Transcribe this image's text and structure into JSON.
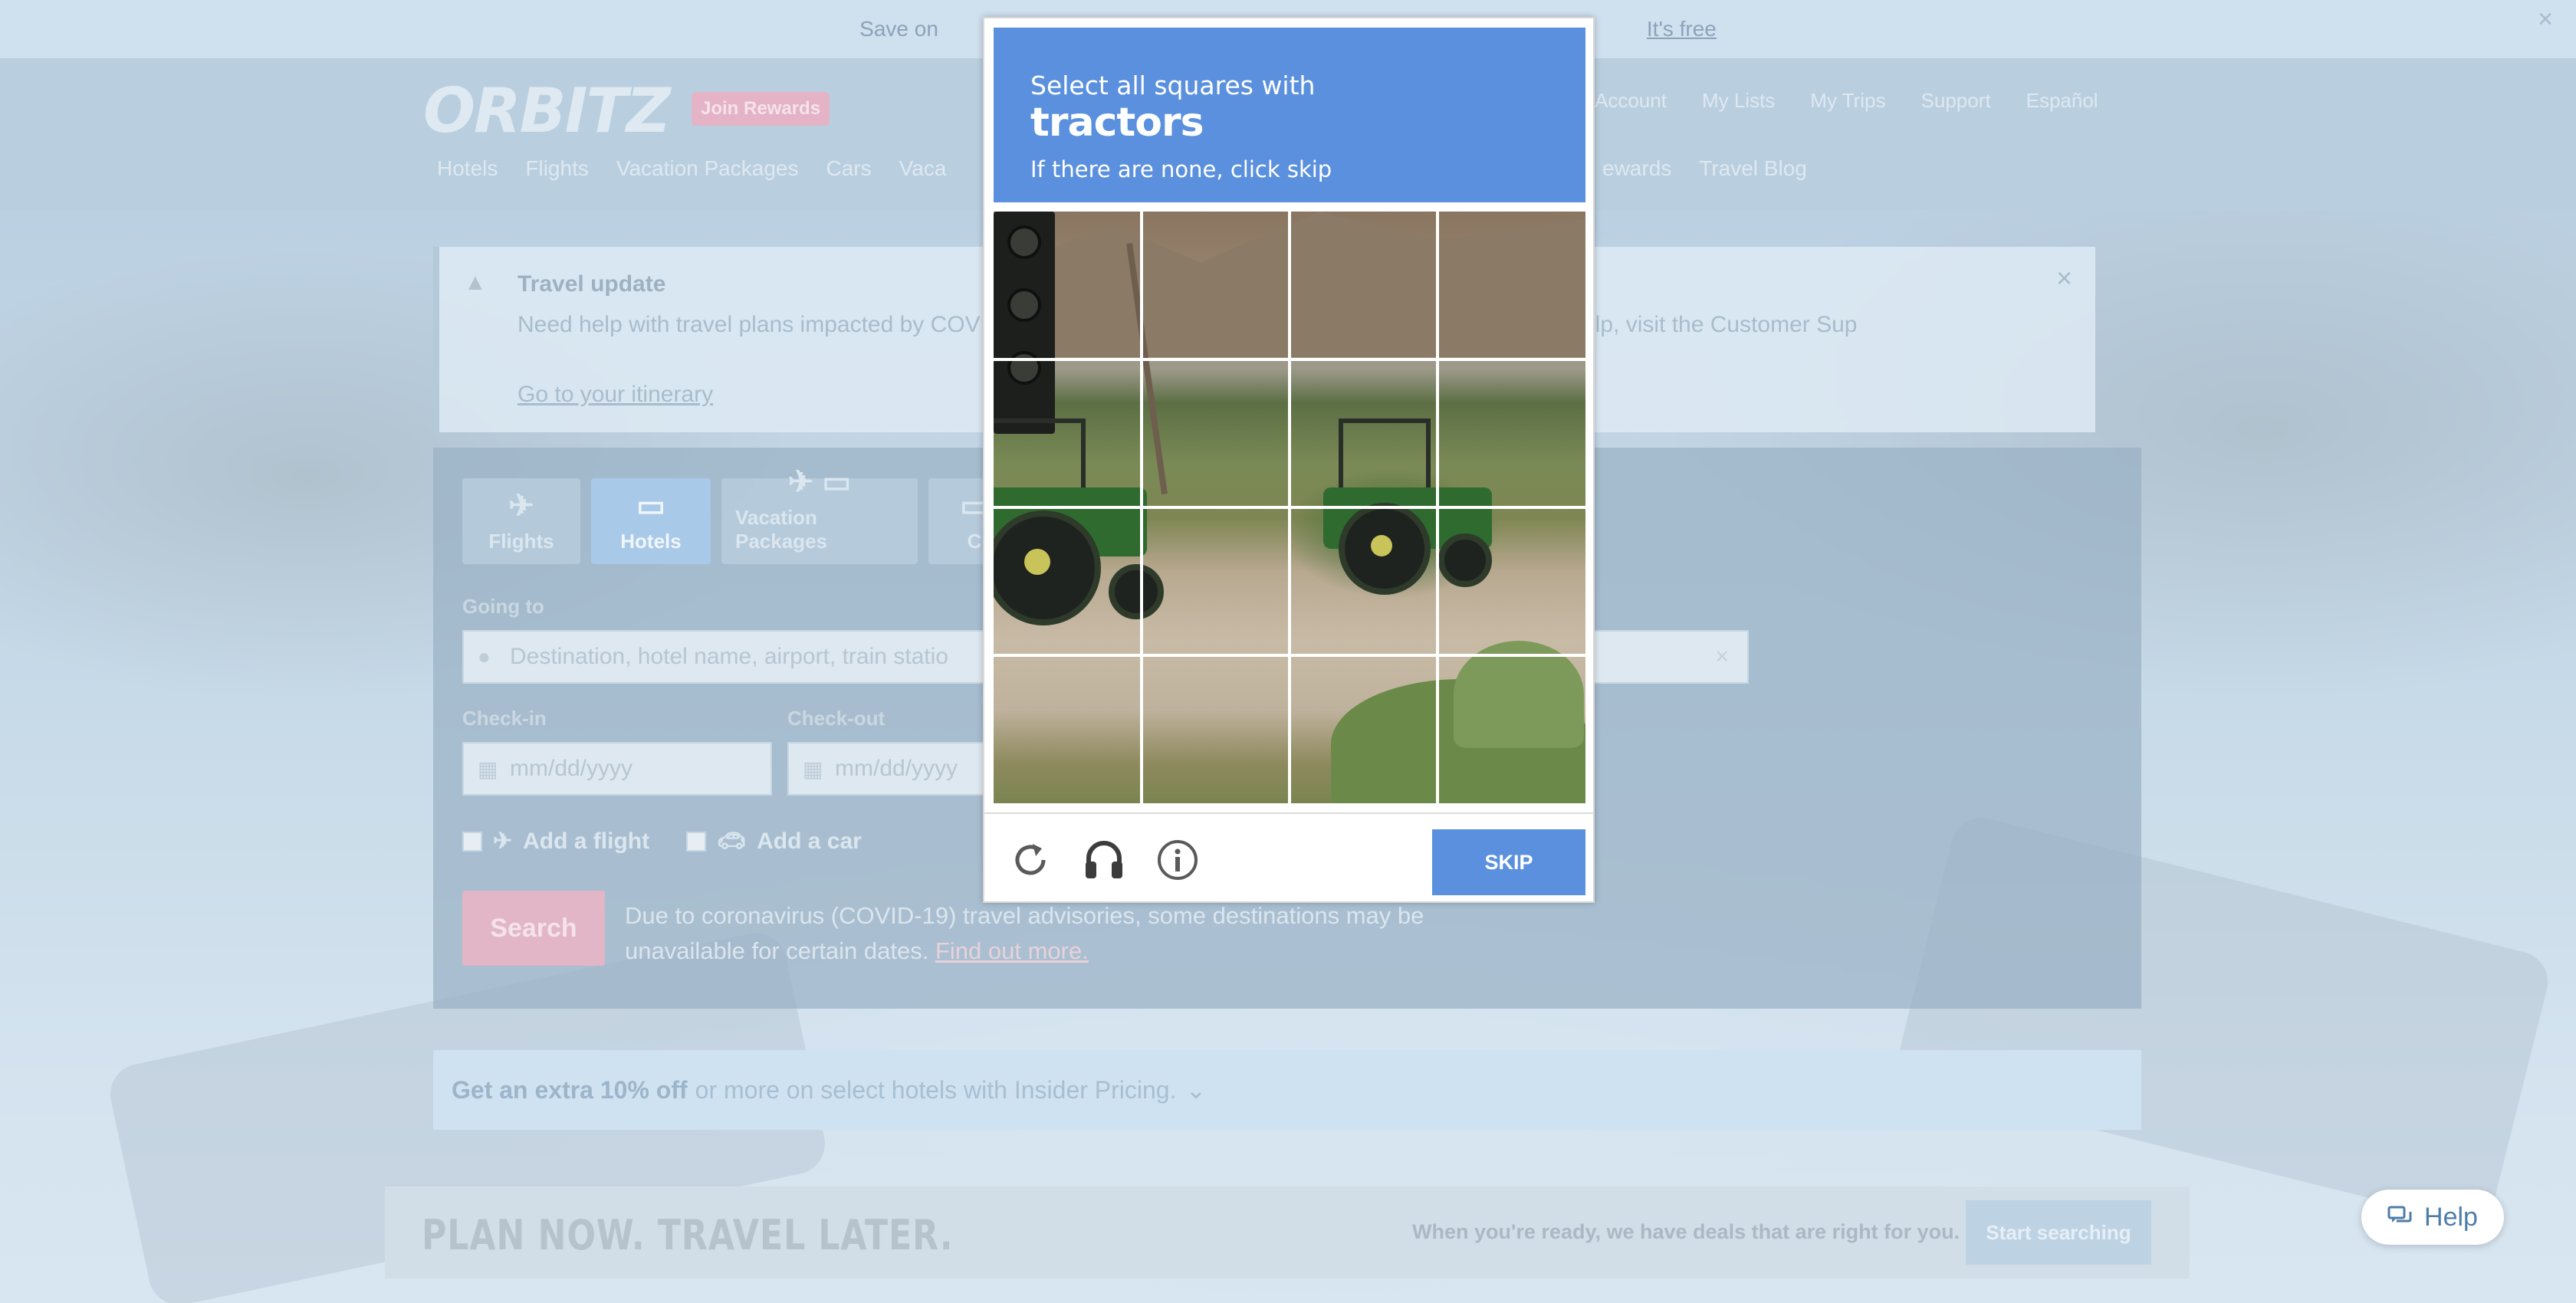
{
  "promo": {
    "text": "Save on",
    "link": "It's free"
  },
  "header": {
    "logo": "ORBITZ",
    "rewards_badge": "Join Rewards",
    "account_nav": [
      "Account",
      "My Lists",
      "My Trips",
      "Support",
      "Español"
    ],
    "main_nav": [
      "Hotels",
      "Flights",
      "Vacation Packages",
      "Cars",
      "Vaca"
    ],
    "main_nav_right": [
      "ewards",
      "Travel Blog"
    ]
  },
  "travel_update": {
    "title": "Travel update",
    "text": "Need help with travel plans impacted by COV                                                                                                   trip. For more information about refund timelines or other help, visit the Customer Sup",
    "link": "Go to your itinerary"
  },
  "search": {
    "tabs": [
      {
        "label": "Flights",
        "icon": "✈"
      },
      {
        "label": "Hotels",
        "icon": "▭"
      },
      {
        "label": "Vacation Packages",
        "icon": "✈ ▭"
      },
      {
        "label": "C",
        "icon": "▭"
      }
    ],
    "going_to_label": "Going to",
    "going_to_placeholder": "Destination, hotel name, airport, train statio",
    "checkin_label": "Check-in",
    "checkout_label": "Check-out",
    "date_placeholder": "mm/dd/yyyy",
    "add_flight": "Add a flight",
    "add_car": "Add a car",
    "search_button": "Search",
    "covid_note": "Due to coronavirus (COVID-19) travel advisories, some destinations may be unavailable for certain dates.",
    "covid_link": "Find out more."
  },
  "insider": {
    "bold": "Get an extra 10% off",
    "rest": "or more on select hotels with Insider Pricing."
  },
  "plan": {
    "title": "PLAN NOW. TRAVEL LATER.",
    "subtitle": "When you're ready, we have deals that are right for you.",
    "button": "Start searching"
  },
  "help": {
    "label": "Help"
  },
  "captcha": {
    "line1": "Select all squares with",
    "target": "tractors",
    "line3": "If there are none, click skip",
    "skip": "SKIP",
    "accent_color": "#5a90de",
    "icons": [
      "refresh-icon",
      "audio-challenge-icon",
      "info-icon"
    ]
  }
}
